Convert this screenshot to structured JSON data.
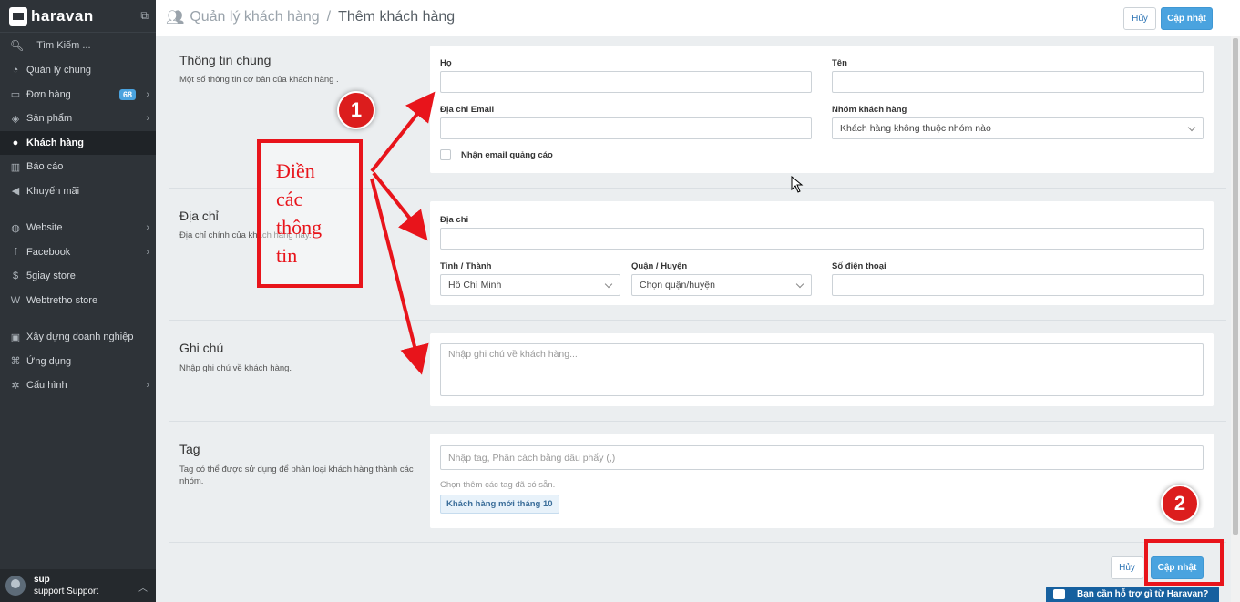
{
  "brand": {
    "name": "haravan"
  },
  "sidebar": {
    "search_label": "Tìm Kiếm ...",
    "items": [
      {
        "label": "Quản lý chung",
        "icon": "dashboard-icon"
      },
      {
        "label": "Đơn hàng",
        "icon": "inbox-icon",
        "badge": "68"
      },
      {
        "label": "Sản phẩm",
        "icon": "tag-icon"
      },
      {
        "label": "Khách hàng",
        "icon": "users-icon"
      },
      {
        "label": "Báo cáo",
        "icon": "bar-chart-icon"
      },
      {
        "label": "Khuyến mãi",
        "icon": "megaphone-icon"
      },
      {
        "label": "Website",
        "icon": "globe-icon"
      },
      {
        "label": "Facebook",
        "icon": "facebook-icon"
      },
      {
        "label": "5giay store",
        "icon": "store-icon"
      },
      {
        "label": "Webtretho store",
        "icon": "w-icon"
      },
      {
        "label": "Xây dựng doanh nghiệp",
        "icon": "money-icon"
      },
      {
        "label": "Ứng dụng",
        "icon": "apps-icon"
      },
      {
        "label": "Cấu hình",
        "icon": "gear-icon"
      }
    ],
    "user": {
      "name": "sup",
      "role": "support Support"
    }
  },
  "header": {
    "breadcrumb_parent": "Quản lý khách hàng",
    "breadcrumb_sep": "/",
    "breadcrumb_current": "Thêm khách hàng",
    "cancel_label": "Hủy",
    "update_label": "Cập nhật"
  },
  "general": {
    "title": "Thông tin chung",
    "desc": "Một số thông tin cơ bản của khách hàng .",
    "last_name_label": "Họ",
    "last_name_value": "",
    "first_name_label": "Tên",
    "first_name_value": "",
    "email_label": "Địa chỉ Email",
    "email_value": "",
    "group_label": "Nhóm khách hàng",
    "group_value": "Khách hàng không thuộc nhóm nào",
    "newsletter_label": "Nhận email quảng cáo"
  },
  "address": {
    "title": "Địa chỉ",
    "desc": "Địa chỉ chính của khách hàng này.",
    "address_label": "Địa chỉ",
    "address_value": "",
    "province_label": "Tỉnh / Thành",
    "province_value": "Hồ Chí Minh",
    "district_label": "Quận / Huyện",
    "district_value": "Chọn quận/huyện",
    "phone_label": "Số điện thoại",
    "phone_value": ""
  },
  "notes": {
    "title": "Ghi chú",
    "desc": "Nhập ghi chú về khách hàng.",
    "placeholder": "Nhập ghi chú về khách hàng..."
  },
  "tags": {
    "title": "Tag",
    "desc": "Tag có thể được sử dụng để phân loại khách hàng thành các nhóm.",
    "placeholder": "Nhập tag, Phân cách bằng dấu phẩy (,)",
    "hint": "Chọn thêm các tag đã có sẵn.",
    "existing": "Khách hàng mới tháng 10"
  },
  "footer": {
    "cancel_label": "Hủy",
    "update_label": "Cập nhật"
  },
  "annotations": {
    "instruction": "Điền các thông tin",
    "step1": "1",
    "step2": "2",
    "color": "#e8141b"
  },
  "help_widget": {
    "label": "Bạn cần hỗ trợ gì từ Haravan?"
  }
}
